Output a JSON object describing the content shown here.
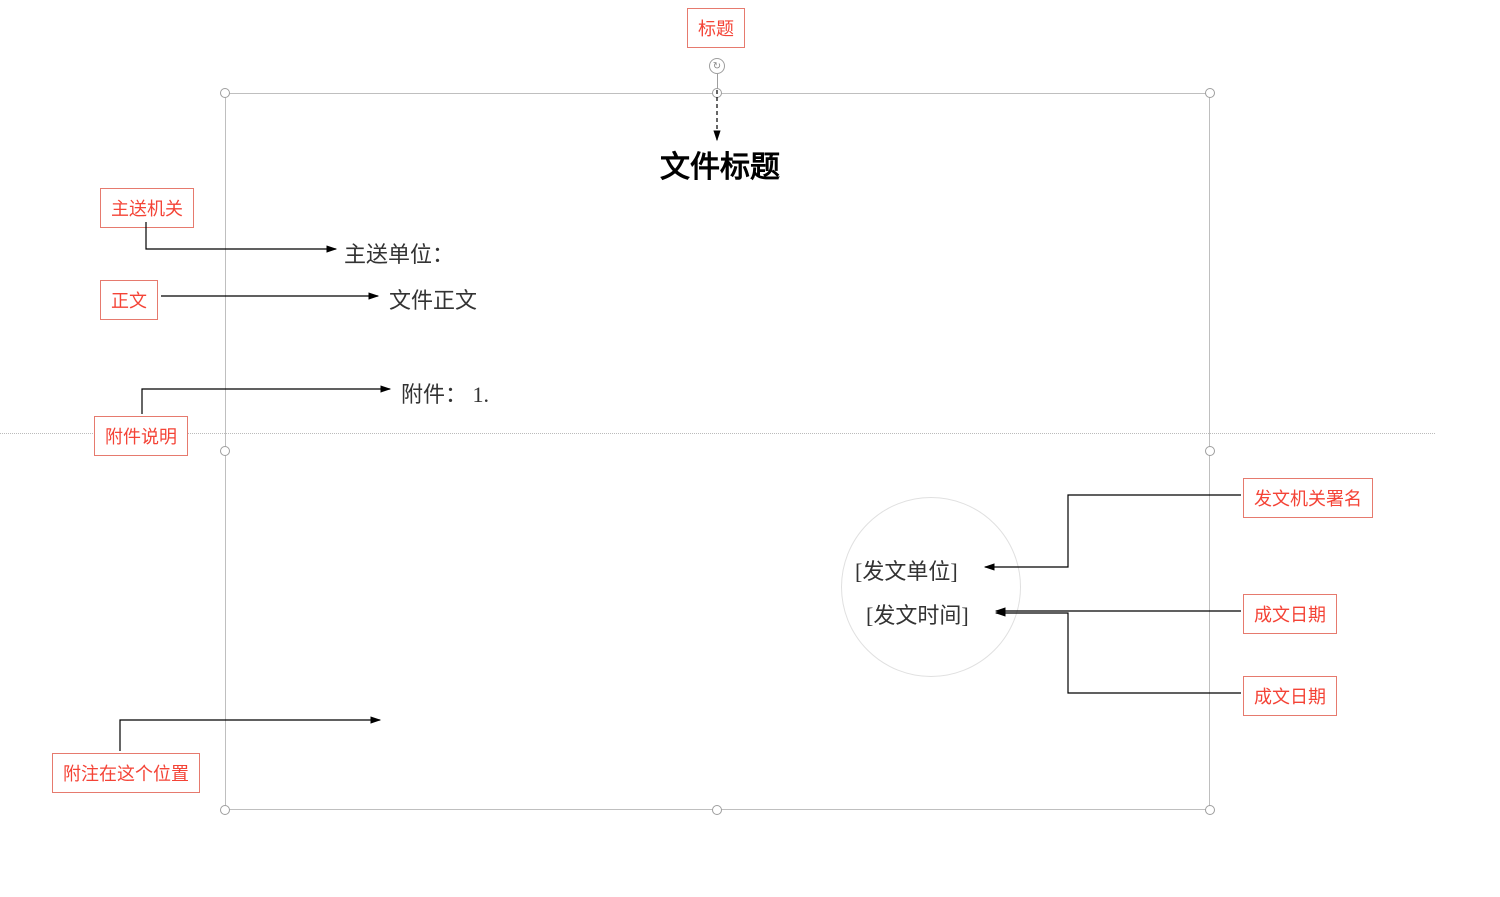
{
  "labels": {
    "title": "标题",
    "recipient": "主送机关",
    "body": "正文",
    "attachment_desc": "附件说明",
    "signature": "发文机关署名",
    "written_date": "成文日期",
    "written_date2": "成文日期",
    "note_position": "附注在这个位置"
  },
  "content": {
    "doc_title": "文件标题",
    "recipient_field": "主送单位：",
    "body_field": "文件正文",
    "attachment_field": "附件：  1.",
    "sender_unit": "[发文单位]",
    "sender_time": "[发文时间]"
  }
}
